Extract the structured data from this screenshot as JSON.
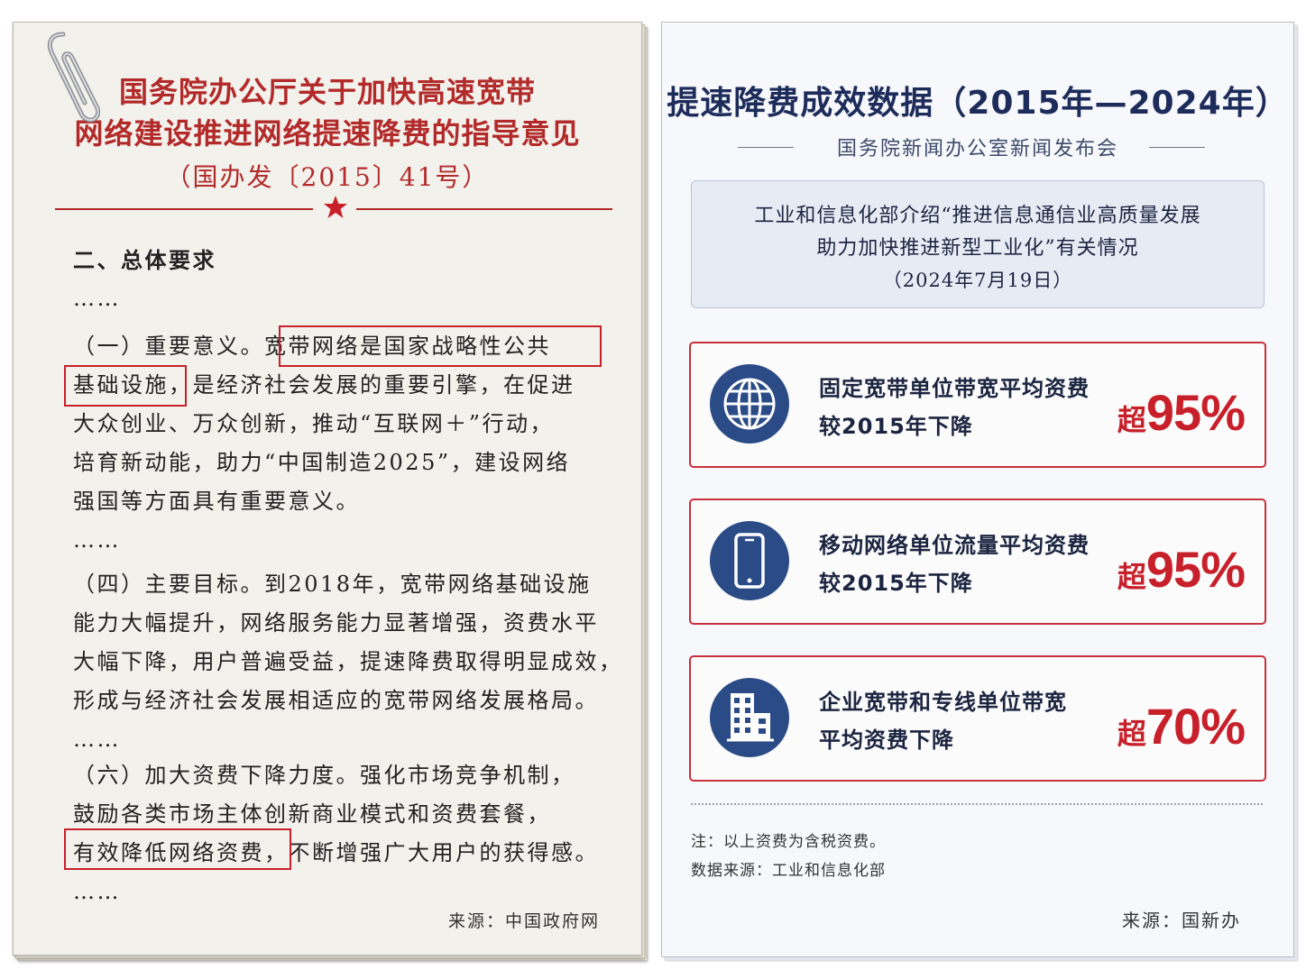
{
  "left": {
    "title_line1": "国务院办公厅关于加快高速宽带",
    "title_line2": "网络建设推进网络提速降费的指导意见",
    "doc_number": "（国办发〔2015〕41号）",
    "section_heading": "二、总体要求",
    "ellipsis": "……",
    "para1": [
      "（一）重要意义。宽带网络是国家战略性公共",
      "基础设施，是经济社会发展的重要引擎，在促进",
      "大众创业、万众创新，推动“互联网＋”行动，",
      "培育新动能，助力“中国制造2025”，建设网络",
      "强国等方面具有重要意义。"
    ],
    "para2": [
      "（四）主要目标。到2018年，宽带网络基础设施",
      "能力大幅提升，网络服务能力显著增强，资费水平",
      "大幅下降，用户普遍受益，提速降费取得明显成效，",
      "形成与经济社会发展相适应的宽带网络发展格局。"
    ],
    "para3": [
      "（六）加大资费下降力度。强化市场竞争机制，",
      "鼓励各类市场主体创新商业模式和资费套餐，",
      "有效降低网络资费，不断增强广大用户的获得感。"
    ],
    "source": "来源：中国政府网"
  },
  "right": {
    "title": "提速降费成效数据（2015年—2024年）",
    "subtitle": "国务院新闻办公室新闻发布会",
    "info_line1": "工业和信息化部介绍“推进信息通信业高质量发展",
    "info_line2": "助力加快推进新型工业化”有关情况",
    "info_date": "（2024年7月19日）",
    "stats": [
      {
        "icon": "globe-icon",
        "label1": "固定宽带单位带宽平均资费",
        "label2": "较2015年下降",
        "prefix": "超",
        "value": "95%"
      },
      {
        "icon": "smartphone-icon",
        "label1": "移动网络单位流量平均资费",
        "label2": "较2015年下降",
        "prefix": "超",
        "value": "95%"
      },
      {
        "icon": "building-icon",
        "label1": "企业宽带和专线单位带宽",
        "label2": "平均资费下降",
        "prefix": "超",
        "value": "70%"
      }
    ],
    "note": "注：以上资费为含税资费。",
    "data_source": "数据来源：工业和信息化部",
    "source": "来源：国新办"
  },
  "colors": {
    "accent_red": "#c8202a",
    "title_red": "#b22a2a",
    "navy": "#1d2c5a",
    "icon_blue": "#2b4b86"
  }
}
